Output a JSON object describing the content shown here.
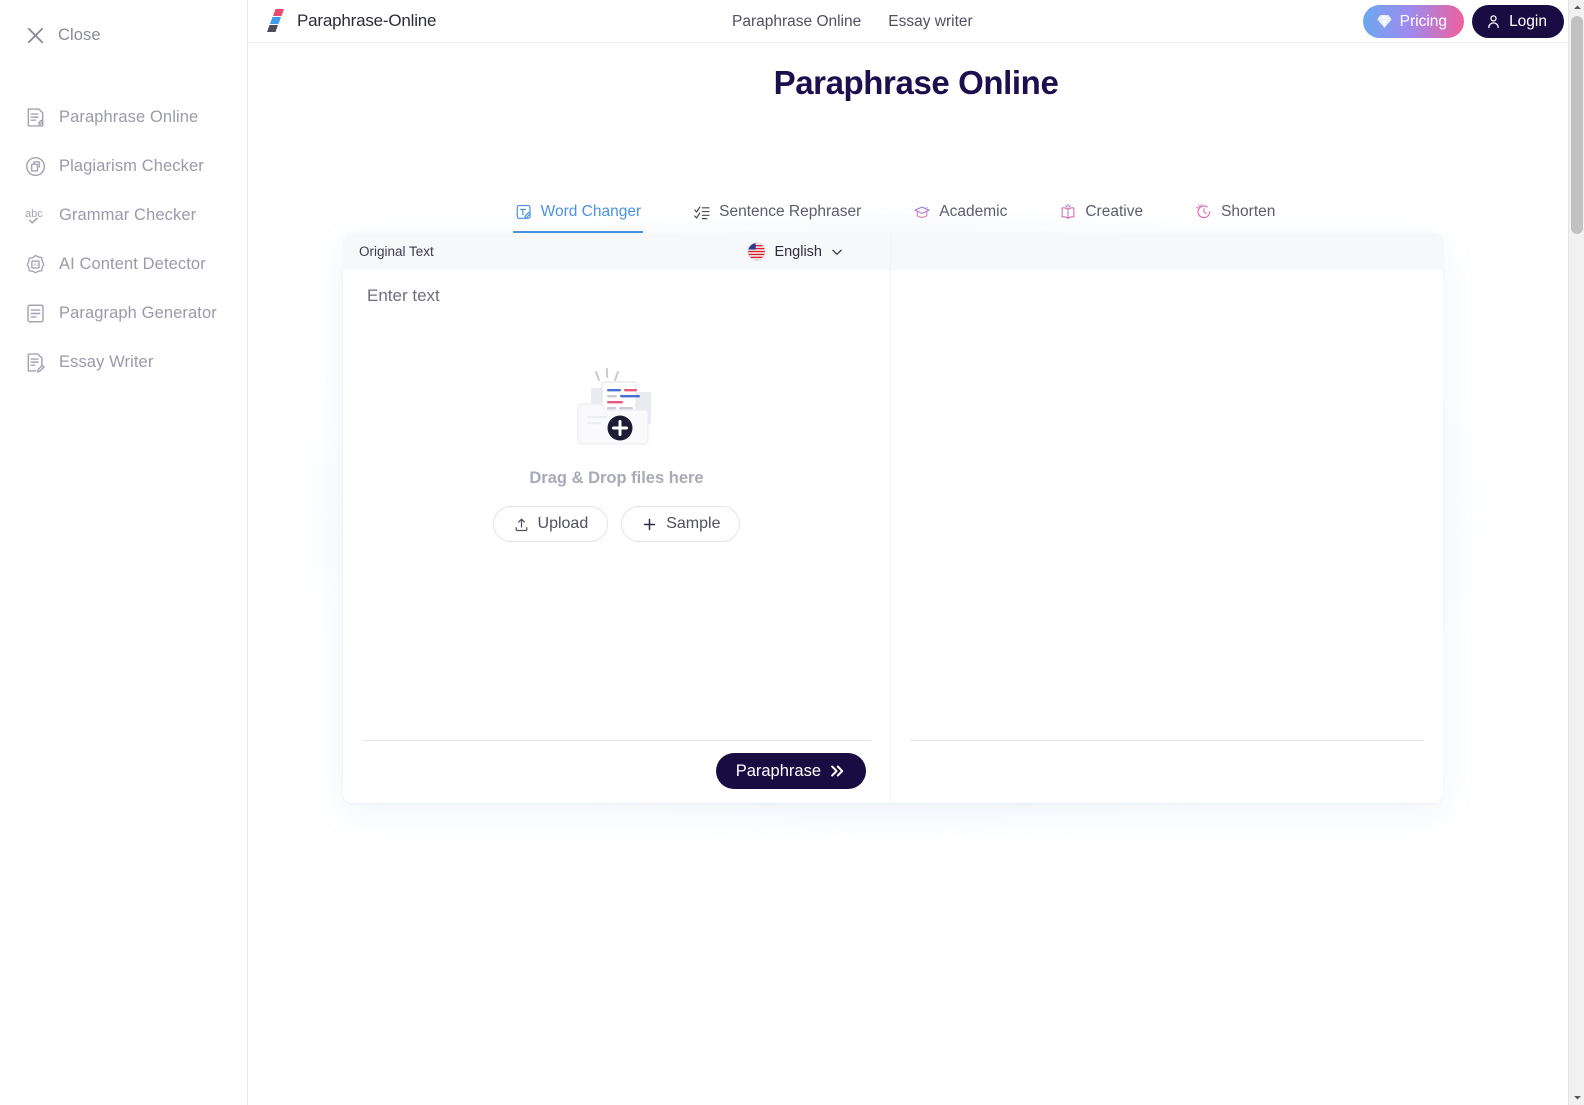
{
  "sidebar": {
    "close": {
      "label": "Close",
      "icon": "close-icon"
    },
    "items": [
      {
        "label": "Paraphrase Online",
        "icon": "document-text-icon"
      },
      {
        "label": "Plagiarism Checker",
        "icon": "copy-circle-icon"
      },
      {
        "label": "Grammar Checker",
        "icon": "abc-check-icon"
      },
      {
        "label": "AI Content Detector",
        "icon": "ai-badge-icon"
      },
      {
        "label": "Paragraph Generator",
        "icon": "paragraph-icon"
      },
      {
        "label": "Essay Writer",
        "icon": "document-pencil-icon"
      }
    ]
  },
  "topbar": {
    "brand": "Paraphrase-Online",
    "brand_logo": "logo-parallelograms-icon",
    "nav": [
      {
        "label": "Paraphrase Online"
      },
      {
        "label": "Essay writer"
      }
    ],
    "pricing": {
      "label": "Pricing",
      "icon": "diamond-icon"
    },
    "login": {
      "label": "Login",
      "icon": "user-icon"
    }
  },
  "page": {
    "title": "Paraphrase Online"
  },
  "tabs": [
    {
      "label": "Word Changer",
      "icon": "text-edit-icon",
      "active": true
    },
    {
      "label": "Sentence Rephraser",
      "icon": "check-list-icon",
      "active": false
    },
    {
      "label": "Academic",
      "icon": "graduation-cap-icon",
      "active": false
    },
    {
      "label": "Creative",
      "icon": "open-book-icon",
      "active": false
    },
    {
      "label": "Shorten",
      "icon": "clock-arrow-icon",
      "active": false
    }
  ],
  "editor": {
    "original": {
      "title": "Original Text",
      "language": {
        "label": "English",
        "flag": "us-flag-icon",
        "chevron": "chevron-down-icon"
      },
      "placeholder": "Enter text",
      "value": "",
      "dropzone": {
        "text": "Drag & Drop files here",
        "art": "folder-documents-plus-icon",
        "upload": {
          "label": "Upload",
          "icon": "upload-icon"
        },
        "sample": {
          "label": "Sample",
          "icon": "plus-icon"
        }
      },
      "action": {
        "label": "Paraphrase",
        "icon": "double-chevron-right-icon"
      }
    },
    "result": {
      "title": "",
      "value": ""
    }
  },
  "colors": {
    "accent_blue": "#4b93e0",
    "dark_navy": "#180c42",
    "pricing_gradient_start": "#6ba8ef",
    "pricing_gradient_end": "#f0609a",
    "muted_text": "#9a9aab"
  },
  "scrollbar": {
    "position": "top"
  }
}
